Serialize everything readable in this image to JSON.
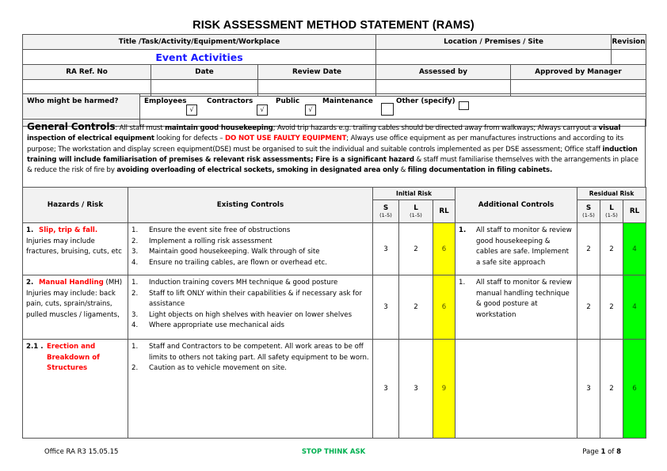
{
  "title": "RISK ASSESSMENT METHOD STATEMENT (RAMS)",
  "info": {
    "title_label": "Title /Task/Activity/Equipment/Workplace",
    "title_value": "Event Activities",
    "location_label": "Location / Premises / Site",
    "location_value": "",
    "revision_label": "Revision",
    "revision_value": "",
    "ra_ref_label": "RA Ref. No",
    "date_label": "Date",
    "review_date_label": "Review Date",
    "assessed_by_label": "Assessed by",
    "approved_label": "Approved by Manager"
  },
  "who_harmed": {
    "label": "Who might be harmed?",
    "options": [
      {
        "label": "Employees",
        "checked": true,
        "mark": "√"
      },
      {
        "label": "Contractors",
        "checked": true,
        "mark": "√"
      },
      {
        "label": "Public",
        "checked": true,
        "mark": "√"
      },
      {
        "label": "Maintenance",
        "checked": false,
        "mark": ""
      },
      {
        "label": "Other (specify)",
        "checked": false,
        "mark": ""
      }
    ]
  },
  "general_controls": {
    "heading": "General Controls",
    "segments": [
      {
        "t": ": All staff must ",
        "s": "n"
      },
      {
        "t": "maintain good housekeeping",
        "s": "b"
      },
      {
        "t": "; Avoid trip hazards e.g. trailing cables should be directed away from walkways; Always carryout a ",
        "s": "n"
      },
      {
        "t": "visual inspection of electrical equipment",
        "s": "b"
      },
      {
        "t": " looking for defects – ",
        "s": "n"
      },
      {
        "t": "DO NOT USE FAULTY EQUIPMENT",
        "s": "r"
      },
      {
        "t": "; Always use office equipment as per manufactures instructions and according to its purpose; The workstation and display screen equipment(DSE) must be organised to suit the individual and suitable controls implemented as per DSE assessment; Office staff ",
        "s": "n"
      },
      {
        "t": "induction training will include familiarisation of premises & relevant risk assessments; Fire is a significant hazard",
        "s": "b"
      },
      {
        "t": " & staff must familiarise themselves with the arrangements in place & reduce the risk of fire by ",
        "s": "n"
      },
      {
        "t": "avoiding overloading of electrical sockets, smoking in designated area only",
        "s": "b"
      },
      {
        "t": " & ",
        "s": "n"
      },
      {
        "t": "filing documentation in filing cabinets.",
        "s": "b"
      }
    ]
  },
  "risk_table": {
    "headers": {
      "hazards": "Hazards / Risk",
      "existing": "Existing Controls",
      "initial": "Initial Risk",
      "additional": "Additional Controls",
      "residual": "Residual Risk",
      "s": "S",
      "l": "L",
      "scale": "(1-5)",
      "rl": "RL"
    },
    "rows": [
      {
        "num": "1.",
        "hazard_title": "Slip, trip & fall.",
        "hazard_desc": " Injuries may include fractures, bruising, cuts, etc",
        "existing": [
          "Ensure the event site free of obstructions",
          "Implement a rolling risk assessment",
          "Maintain good housekeeping. Walk through of site",
          "Ensure no trailing cables, are flown or overhead etc."
        ],
        "initial": {
          "s": "3",
          "l": "2",
          "rl": "6"
        },
        "additional": [
          "All staff to monitor & review good housekeeping & cables are safe. Implement a safe site approach"
        ],
        "residual": {
          "s": "2",
          "l": "2",
          "rl": "4"
        }
      },
      {
        "num": "2.",
        "hazard_title": "Manual Handling",
        "hazard_desc": " (MH) Injuries may include: back pain, cuts, sprain/strains, pulled muscles / ligaments,",
        "existing": [
          "Induction training covers MH technique & good posture",
          "Staff to lift ONLY within their capabilities & if necessary ask for assistance",
          "Light objects on high shelves with heavier on lower shelves",
          "Where appropriate use mechanical aids"
        ],
        "initial": {
          "s": "3",
          "l": "2",
          "rl": "6"
        },
        "additional": [
          "All staff to monitor & review manual handling technique & good posture at workstation"
        ],
        "residual": {
          "s": "2",
          "l": "2",
          "rl": "4"
        }
      },
      {
        "num": "2.1 .",
        "hazard_title": "Erection and Breakdown of Structures",
        "hazard_desc": "",
        "existing": [
          "Staff and Contractors to be competent. All work areas to be off limits to others not taking part. All safety equipment to be worn.",
          "Caution as to vehicle movement on site."
        ],
        "initial": {
          "s": "3",
          "l": "3",
          "rl": "9"
        },
        "additional": [],
        "residual": {
          "s": "3",
          "l": "2",
          "rl": "6"
        }
      }
    ]
  },
  "footer": {
    "left": "Office RA R3 15.05.15",
    "center": "STOP THINK ASK",
    "page_prefix": "Page ",
    "page_current": "1",
    "page_mid": " of ",
    "page_total": "8"
  },
  "colors": {
    "initial_rl": "#ffff00",
    "residual_rl": "#00ff00",
    "hazard_title": "#ff0000",
    "event_title": "#1a1aff",
    "footer_center": "#00b050"
  }
}
